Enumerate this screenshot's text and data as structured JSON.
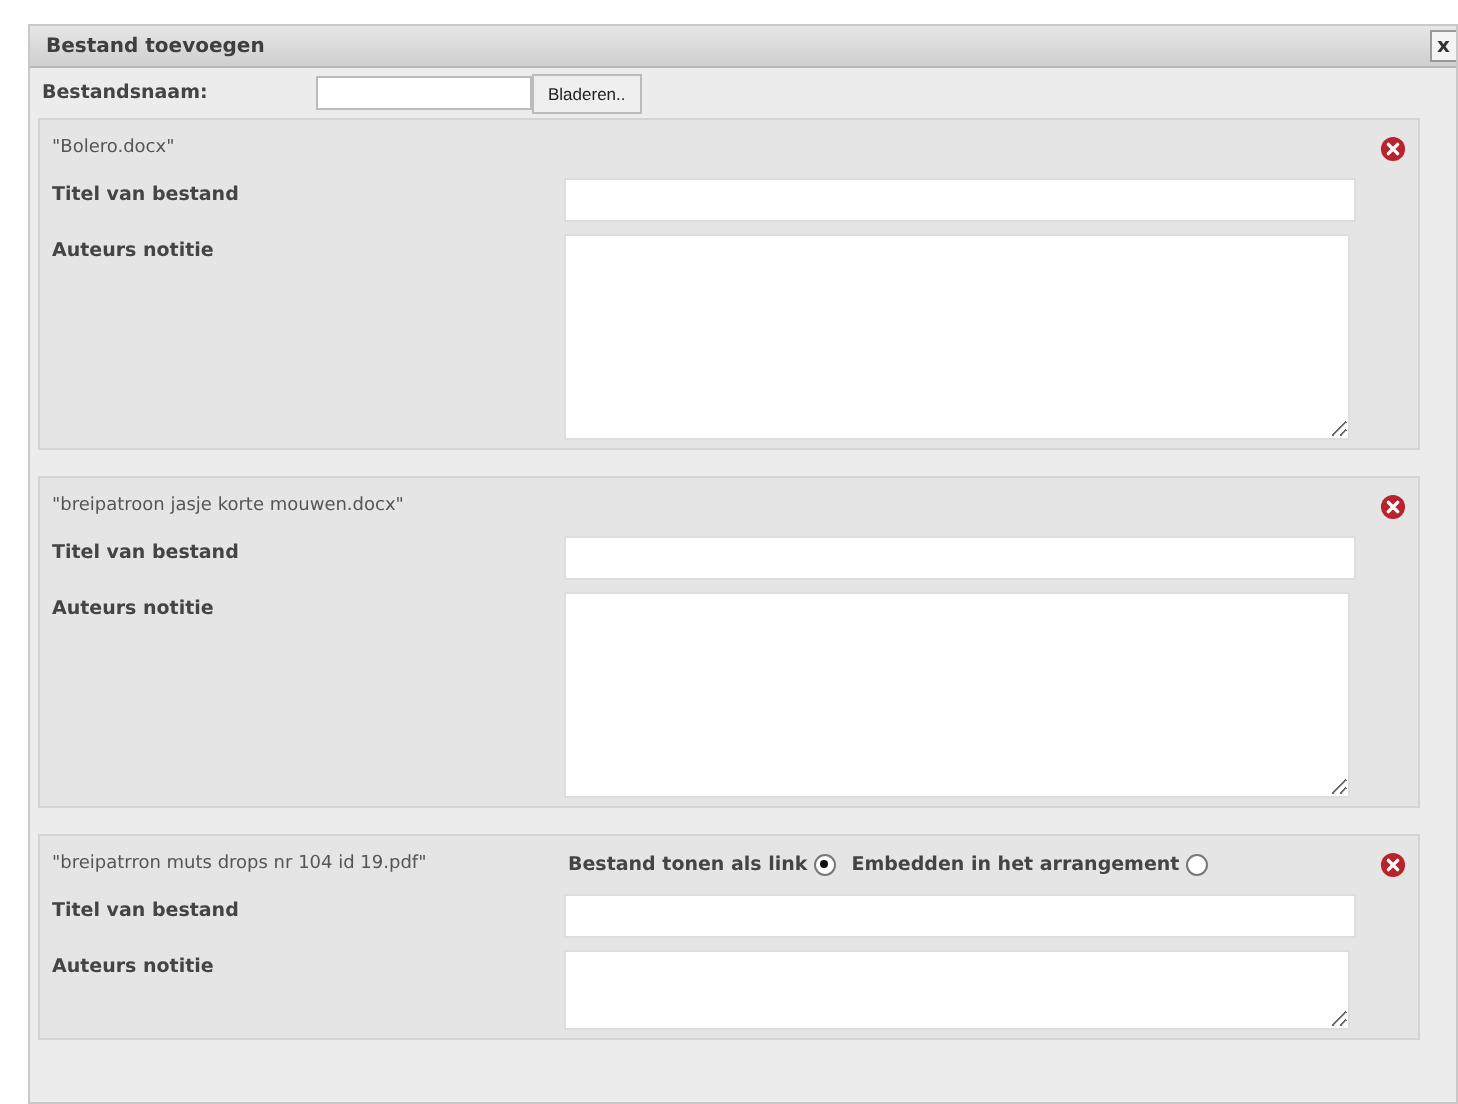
{
  "dialog": {
    "title": "Bestand toevoegen",
    "close": "x"
  },
  "filename": {
    "label": "Bestandsnaam:",
    "button": "Bladeren.."
  },
  "files": [
    {
      "name": "\"Bolero.docx\"",
      "title_label": "Titel van bestand",
      "note_label": "Auteurs notitie"
    },
    {
      "name": "\"breipatroon jasje korte mouwen.docx\"",
      "title_label": "Titel van bestand",
      "note_label": "Auteurs notitie"
    },
    {
      "name": "\"breipatrron muts drops nr 104 id 19.pdf\"",
      "title_label": "Titel van bestand",
      "note_label": "Auteurs notitie",
      "display_options": [
        {
          "label": "Bestand tonen als link",
          "selected": true
        },
        {
          "label": "Embedden in het arrangement",
          "selected": false
        }
      ]
    }
  ]
}
